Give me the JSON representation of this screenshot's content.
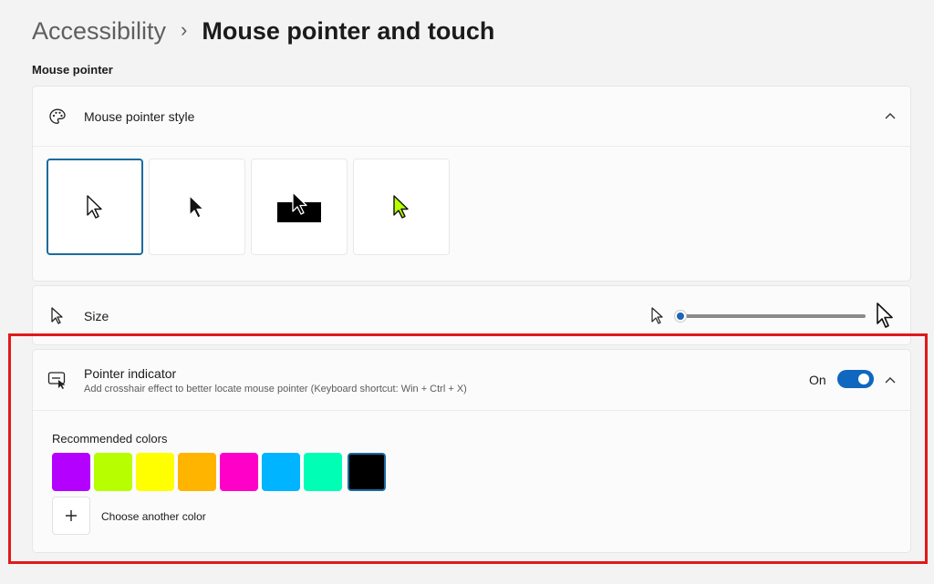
{
  "breadcrumb": {
    "parent": "Accessibility",
    "separator": "›",
    "current": "Mouse pointer and touch"
  },
  "section_label": "Mouse pointer",
  "pointer_style": {
    "title": "Mouse pointer style",
    "icon": "palette-icon",
    "expanded": true,
    "options": [
      {
        "name": "white-pointer",
        "selected": true
      },
      {
        "name": "black-pointer",
        "selected": false
      },
      {
        "name": "inverted-pointer",
        "selected": false
      },
      {
        "name": "custom-pointer",
        "selected": false
      }
    ]
  },
  "size": {
    "title": "Size",
    "icon": "cursor-icon",
    "value": 0
  },
  "pointer_indicator": {
    "title": "Pointer indicator",
    "description": "Add crosshair effect to better locate mouse pointer (Keyboard shortcut: Win + Ctrl + X)",
    "icon": "pointer-indicator-icon",
    "toggle_label": "On",
    "toggle_on": true,
    "expanded": true
  },
  "recommended_colors": {
    "label": "Recommended colors",
    "swatches": [
      "#b400ff",
      "#b7ff00",
      "#ffff00",
      "#ffb400",
      "#ff00c8",
      "#00b4ff",
      "#00ffb4",
      "#000000"
    ],
    "selected_index": 7,
    "add_label": "Choose another color"
  },
  "colors": {
    "accent": "#0f67c0",
    "selected_border": "#1c6a9e",
    "highlight": "#e11919"
  }
}
